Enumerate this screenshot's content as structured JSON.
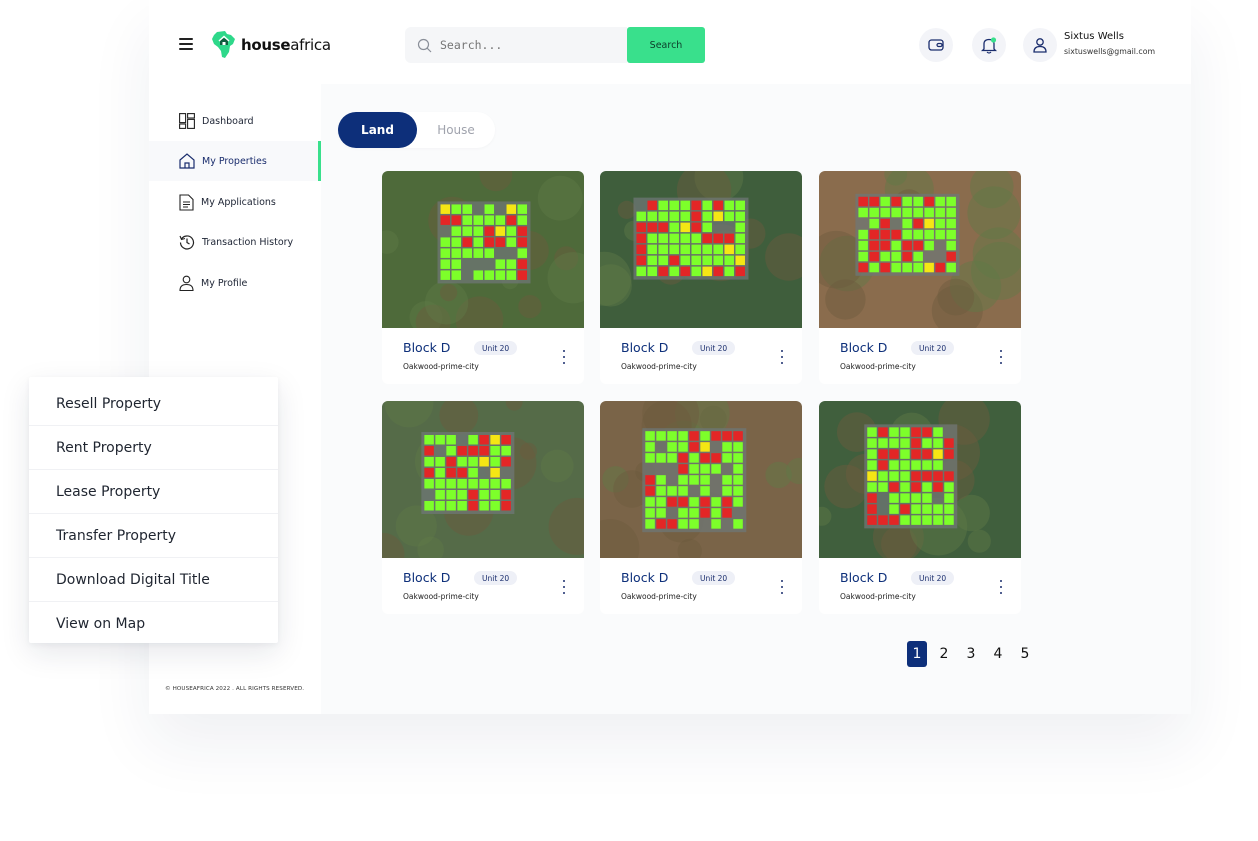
{
  "header": {
    "logo_bold": "house",
    "logo_light": "africa",
    "search_placeholder": "Search...",
    "search_button": "Search",
    "user_name": "Sixtus Wells",
    "user_email": "sixtuswells@gmail.com"
  },
  "colors": {
    "accent": "#39e08c",
    "brand": "#0d2f7a"
  },
  "sidebar": {
    "items": [
      {
        "label": "Dashboard",
        "icon": "dashboard-icon"
      },
      {
        "label": "My Properties",
        "icon": "home-icon",
        "active": true
      },
      {
        "label": "My Applications",
        "icon": "document-icon"
      },
      {
        "label": "Transaction History",
        "icon": "history-icon"
      },
      {
        "label": "My Profile",
        "icon": "user-icon"
      }
    ],
    "copyright": "© HOUSEAFRICA 2022 . ALL RIGHTS RESERVED."
  },
  "tabs": [
    {
      "label": "Land",
      "active": true
    },
    {
      "label": "House",
      "active": false
    }
  ],
  "cards": [
    {
      "block": "Block D",
      "unit": "Unit 20",
      "location": "Oakwood-prime-city"
    },
    {
      "block": "Block D",
      "unit": "Unit 20",
      "location": "Oakwood-prime-city"
    },
    {
      "block": "Block D",
      "unit": "Unit 20",
      "location": "Oakwood-prime-city"
    },
    {
      "block": "Block D",
      "unit": "Unit 20",
      "location": "Oakwood-prime-city"
    },
    {
      "block": "Block D",
      "unit": "Unit 20",
      "location": "Oakwood-prime-city"
    },
    {
      "block": "Block D",
      "unit": "Unit 20",
      "location": "Oakwood-prime-city"
    }
  ],
  "pagination": {
    "pages": [
      "1",
      "2",
      "3",
      "4",
      "5"
    ],
    "current": "1"
  },
  "context_menu": {
    "items": [
      "Resell Property",
      "Rent Property",
      "Lease Property",
      "Transfer Property",
      "Download Digital Title",
      "View on Map"
    ]
  }
}
